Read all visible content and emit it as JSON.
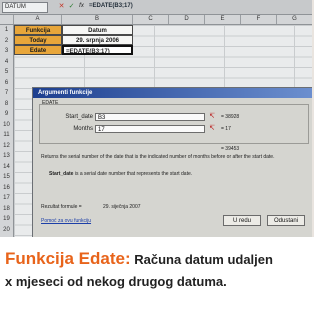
{
  "spreadsheet": {
    "name_box": "DATUM",
    "fx_label": "fx",
    "formula": "=EDATE(B3;17)",
    "columns": [
      "A",
      "B",
      "C",
      "D",
      "E",
      "F",
      "G"
    ],
    "rows": [
      "1",
      "2",
      "3",
      "4",
      "5",
      "6",
      "7",
      "8",
      "9",
      "10",
      "11",
      "12",
      "13",
      "14",
      "15",
      "16",
      "17",
      "18",
      "19",
      "20"
    ],
    "headers": {
      "a": "Funkcija",
      "b": "Datum"
    },
    "row2": {
      "label": "Today",
      "value": "29. srpnja 2006"
    },
    "row3": {
      "label": "Edate",
      "value": "=EDATE(B3;17)"
    }
  },
  "dialog": {
    "title": "Argumenti funkcije",
    "group_label": "EDATE",
    "args": [
      {
        "label": "Start_date",
        "value": "B3",
        "result": "= 38928"
      },
      {
        "label": "Months",
        "value": "17",
        "result": "= 17"
      }
    ],
    "result_line": "= 39453",
    "description": "Returns the serial number of the date that is the indicated number of months before or after the start date.",
    "arg_help_name": "Start_date",
    "arg_help_text": "is a serial date number that represents the start date.",
    "formula_result_label": "Rezultat formule =",
    "formula_result_value": "29. siječnja 2007",
    "help_link": "Pomoć za ovu funkciju",
    "ok": "U redu",
    "cancel": "Odustani"
  },
  "caption": {
    "title": "Funkcija Edate:",
    "line1": "Računa datum udaljen",
    "line2": "x mjeseci od nekog drugog datuma."
  },
  "colors": {
    "caption_accent": "#e8641b",
    "cell_orange": "#e8a63a",
    "title_bar": "#1d3f8f"
  }
}
